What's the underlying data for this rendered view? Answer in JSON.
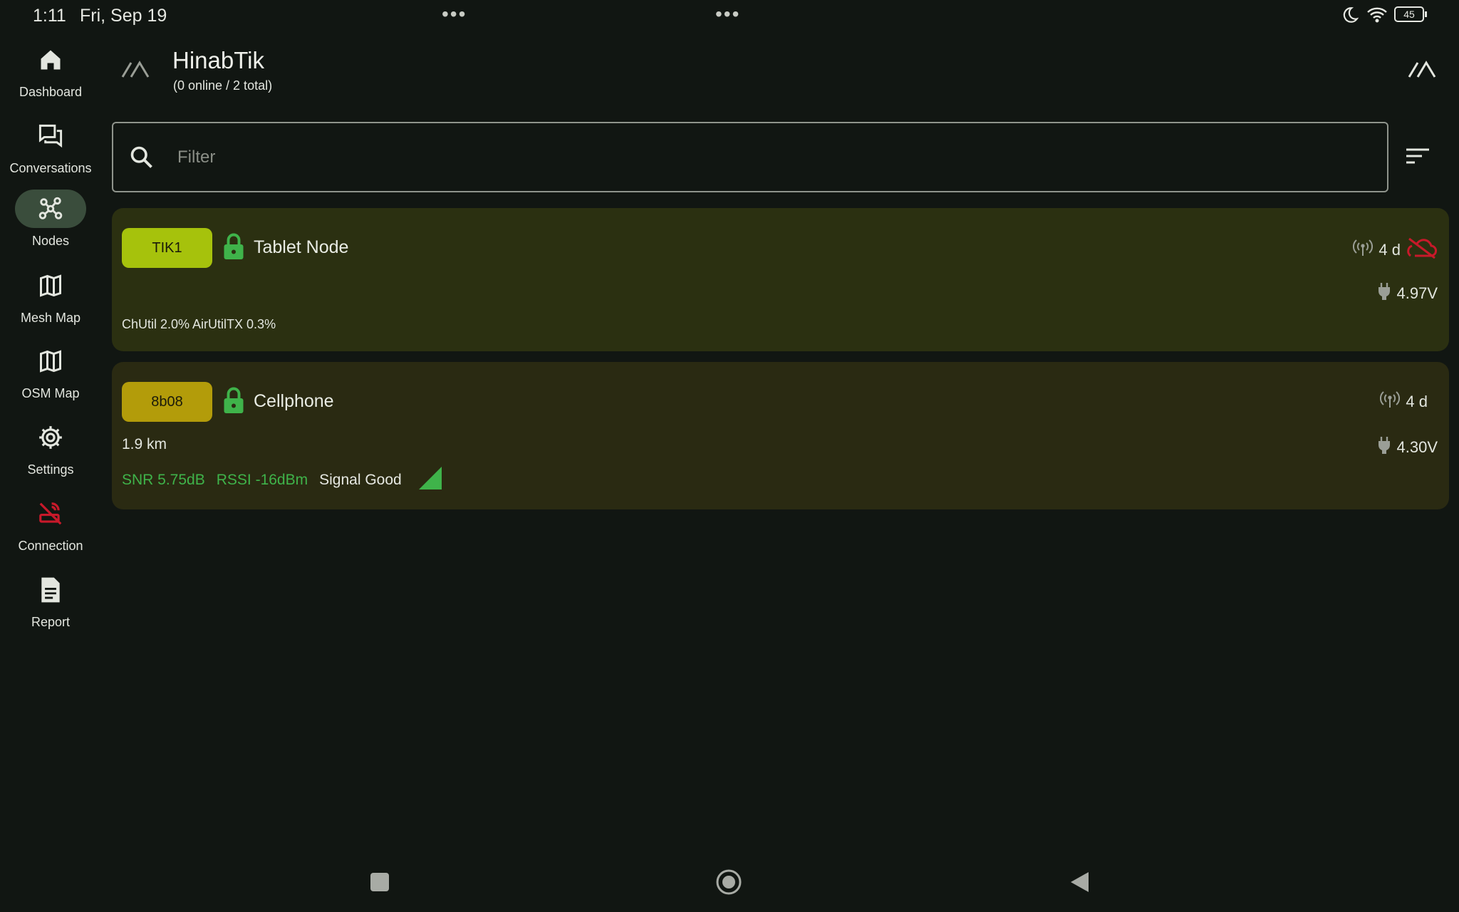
{
  "status_bar": {
    "time": "1:11",
    "date": "Fri, Sep 19",
    "battery": "45",
    "dots_left": "•••",
    "dots_right": "•••"
  },
  "nav": [
    {
      "label": "Dashboard",
      "icon": "home-icon"
    },
    {
      "label": "Conversations",
      "icon": "chat-icon"
    },
    {
      "label": "Nodes",
      "icon": "nodes-icon",
      "active": true
    },
    {
      "label": "Mesh Map",
      "icon": "map-icon"
    },
    {
      "label": "OSM Map",
      "icon": "map-icon"
    },
    {
      "label": "Settings",
      "icon": "gear-icon"
    },
    {
      "label": "Connection",
      "icon": "connection-off-icon"
    },
    {
      "label": "Report",
      "icon": "report-icon"
    }
  ],
  "header": {
    "title": "HinabTik",
    "subtitle": "(0 online / 2 total)"
  },
  "filter": {
    "placeholder": "Filter",
    "value": ""
  },
  "nodes": [
    {
      "short": "TIK1",
      "name": "Tablet Node",
      "last_heard": "4 d",
      "voltage": "4.97V",
      "util": "ChUtil 2.0% AirUtilTX 0.3%"
    },
    {
      "short": "8b08",
      "name": "Cellphone",
      "last_heard": "4 d",
      "distance": "1.9 km",
      "voltage": "4.30V",
      "snr": "SNR 5.75dB",
      "rssi": "RSSI -16dBm",
      "signal": "Signal Good"
    }
  ],
  "colors": {
    "accent_green": "#3fb34a",
    "chip1": "#a6c20c",
    "chip2": "#b39c0a",
    "offline_red": "#c8192a"
  }
}
